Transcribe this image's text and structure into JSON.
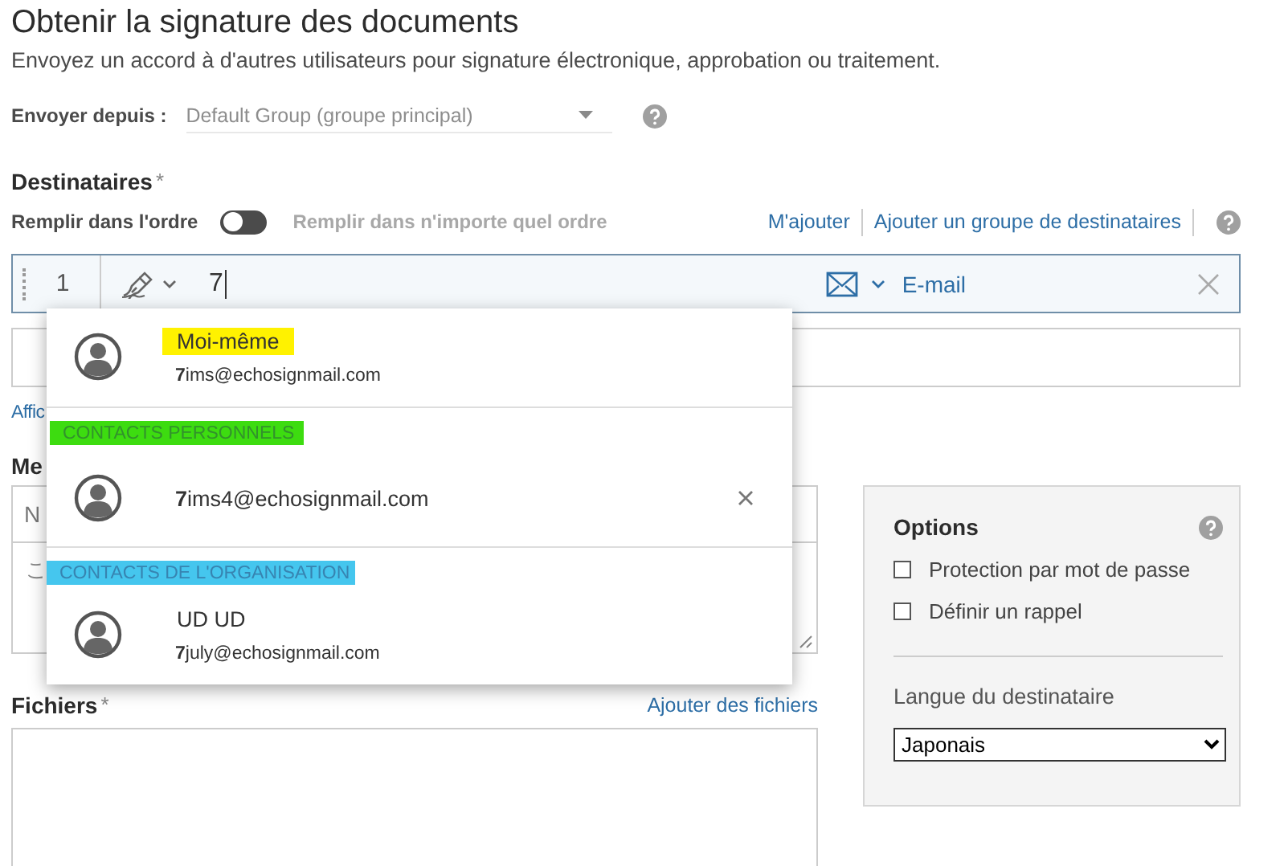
{
  "page": {
    "title": "Obtenir la signature des documents",
    "subtitle": "Envoyez un accord à d'autres utilisateurs pour signature électronique, approbation ou traitement."
  },
  "sender": {
    "label": "Envoyer depuis :",
    "value": "Default Group (groupe principal)"
  },
  "recipients": {
    "title": "Destinataires",
    "required_mark": "*",
    "order": {
      "label_on": "Remplir dans l'ordre",
      "label_off": "Remplir dans n'importe quel ordre",
      "on": false
    },
    "links": [
      "M'ajouter",
      "Ajouter un groupe de destinataires"
    ],
    "rows": [
      {
        "number": "1",
        "value": "7",
        "method": "E-mail"
      }
    ],
    "show_link": "Affic"
  },
  "dropdown": {
    "sections": [
      {
        "items": [
          {
            "name": "Moi-même",
            "color": "#fff200",
            "email": "**7**ims@echosignmail.com",
            "removable": false
          }
        ]
      },
      {
        "header": "CONTACTS PERSONNELS",
        "color": "#3ddc10",
        "items": [
          {
            "email": "**7**ims4@echosignmail.com",
            "removable": true
          }
        ]
      },
      {
        "header": "CONTACTS DE L'ORGANISATION",
        "color": "#45c6ee",
        "items": [
          {
            "name": "UD UD",
            "email": "**7**july@echosignmail.com",
            "removable": false
          }
        ]
      }
    ]
  },
  "message": {
    "title": "Me",
    "name_placeholder": "N",
    "body": "こ"
  },
  "files": {
    "title": "Fichiers",
    "required_mark": "*",
    "link": "Ajouter des fichiers"
  },
  "options": {
    "title": "Options",
    "checkboxes": [
      {
        "label": "Protection par mot de passe",
        "checked": false
      },
      {
        "label": "Définir un rappel",
        "checked": false
      }
    ],
    "language_label": "Langue du destinataire",
    "language": "Japonais"
  }
}
